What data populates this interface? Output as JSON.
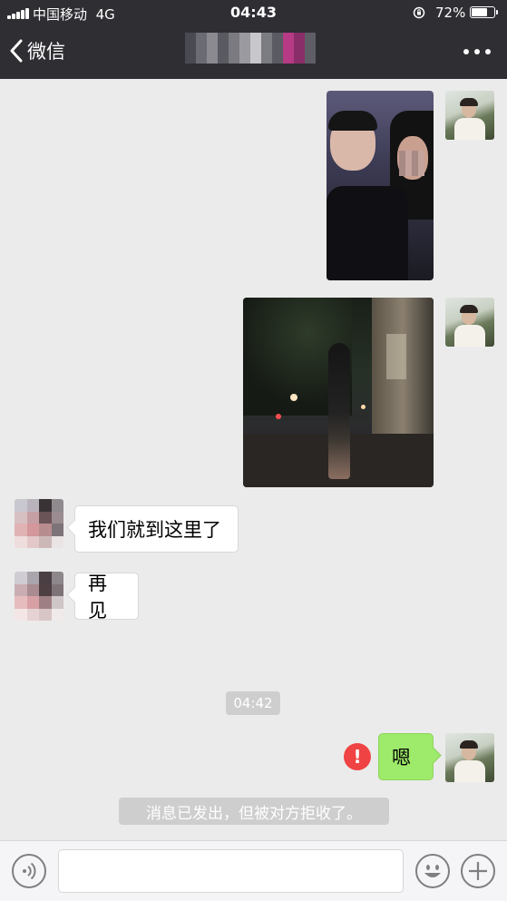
{
  "status_bar": {
    "carrier": "中国移动",
    "network": "4G",
    "time": "04:43",
    "battery_percent": "72%",
    "battery_level": 0.72
  },
  "nav": {
    "back_label": "微信",
    "back_icon": "chevron-left-icon",
    "more_icon": "more-dots-icon"
  },
  "messages": {
    "photo_1": {
      "icon": "photo-couple"
    },
    "photo_2": {
      "icon": "photo-night-street"
    },
    "in_1": "我们就到这里了",
    "in_2": "再见",
    "timestamp": "04:42",
    "out_1": "嗯",
    "failed_icon": "exclamation-icon",
    "system_notice": "消息已发出，但被对方拒收了。"
  },
  "input_bar": {
    "voice_icon": "voice-icon",
    "emoji_icon": "emoji-icon",
    "plus_icon": "plus-icon",
    "text_value": ""
  },
  "colors": {
    "nav_bg": "#2e2e33",
    "chat_bg": "#ebebeb",
    "outgoing_bubble": "#9eea6a",
    "error_red": "#f04343"
  }
}
